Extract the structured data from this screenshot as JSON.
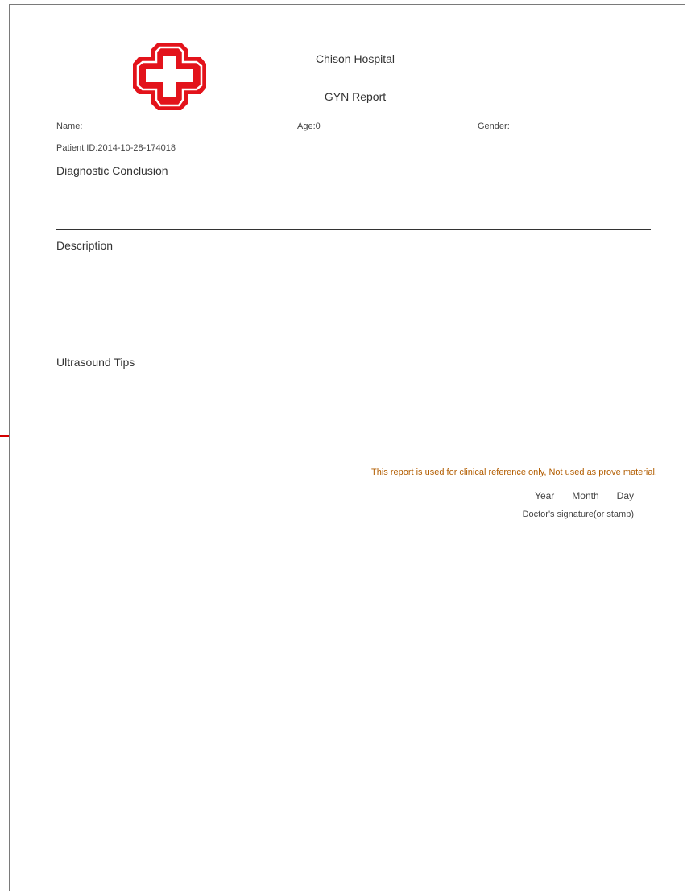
{
  "report": {
    "hospital_name": "Chison Hospital",
    "title": "GYN Report",
    "patient": {
      "name_label": "Name:",
      "age_label": "Age:0",
      "gender_label": "Gender:",
      "id_label": "Patient ID:2014-10-28-174018"
    },
    "sections": {
      "diagnostic_conclusion": "Diagnostic Conclusion",
      "description": "Description",
      "ultrasound_tips": "Ultrasound Tips"
    },
    "footer": {
      "disclaimer": "This report is used for clinical reference only, Not used as prove material.",
      "year": "Year",
      "month": "Month",
      "day": "Day",
      "signature": "Doctor's signature(or stamp)"
    }
  },
  "colors": {
    "logo_red": "#e3131b",
    "disclaimer": "#b25d00",
    "edge_marker": "#d40000"
  },
  "icons": {
    "logo": "red-cross-icon"
  }
}
